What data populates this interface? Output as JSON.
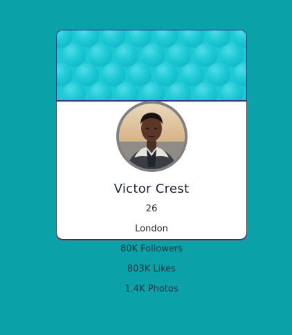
{
  "colors": {
    "background": "#0aa1a8",
    "card_background": "#ffffff",
    "header_background": "#1ec9d6",
    "card_border_top": "#2a2f8a",
    "card_border_bottom": "#8a2a3a",
    "avatar_ring": "#808080",
    "text_primary": "#1e2433"
  },
  "profile": {
    "name": "Victor Crest",
    "age": "26",
    "city": "London",
    "avatar_icon": "profile-photo"
  },
  "stats": {
    "followers": "80K Followers",
    "likes": "803K Likes",
    "photos": "1.4K Photos"
  }
}
